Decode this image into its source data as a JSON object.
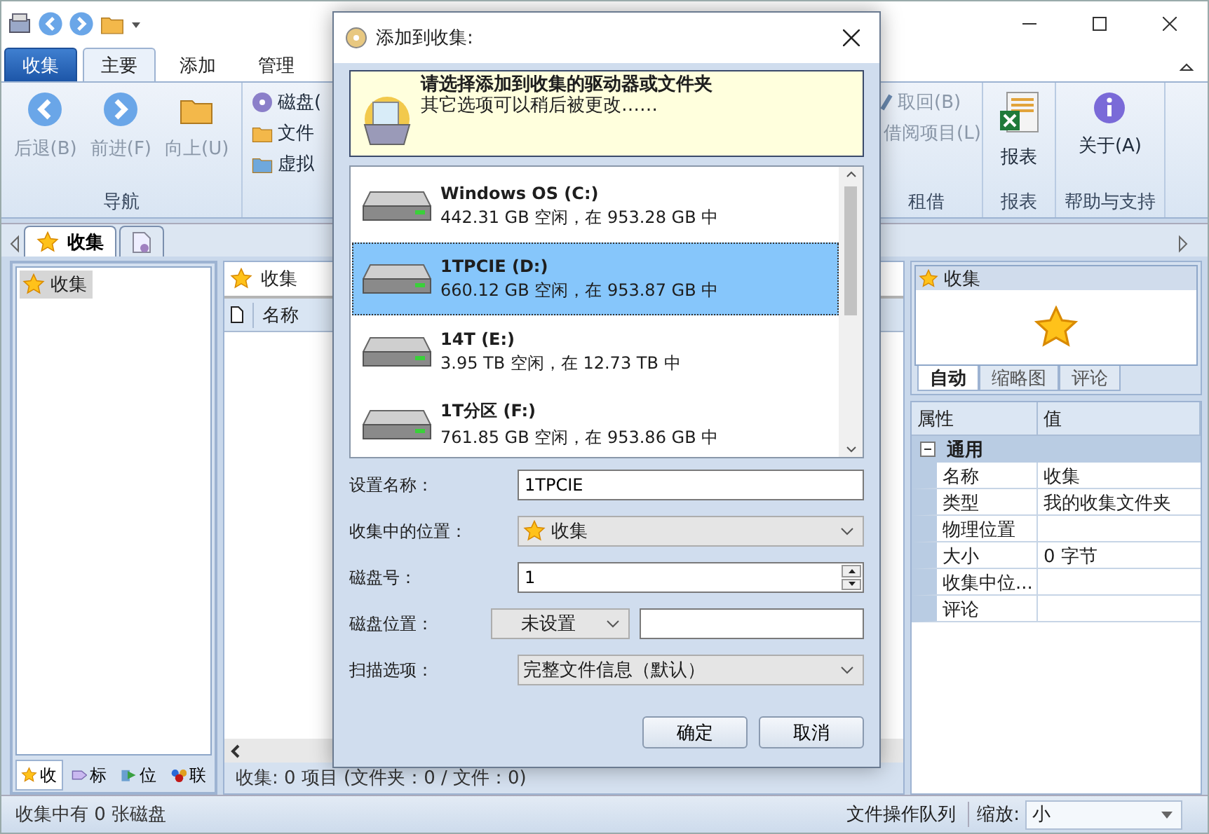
{
  "ribbon": {
    "tabs": [
      {
        "label": "收集",
        "kind": "file",
        "selected": false
      },
      {
        "label": "主要",
        "kind": "tab",
        "selected": true
      },
      {
        "label": "添加",
        "kind": "tab",
        "selected": false
      },
      {
        "label": "管理",
        "kind": "tab",
        "selected": false
      }
    ],
    "groups": [
      {
        "label": "导航",
        "kind": "large",
        "items": [
          {
            "label": "后退(B)",
            "kind": "back",
            "disabled": true
          },
          {
            "label": "前进(F)",
            "kind": "forward",
            "disabled": true
          },
          {
            "label": "向上(U)",
            "kind": "up",
            "disabled": true
          }
        ]
      },
      {
        "kind": "small",
        "items": [
          {
            "label": "磁盘(",
            "kind": "disc",
            "disabled": false
          },
          {
            "label": "文件",
            "kind": "folder",
            "disabled": false
          },
          {
            "label": "虚拟",
            "kind": "vfolder",
            "disabled": false
          }
        ]
      },
      {
        "label": "租借",
        "kind": "small",
        "items": [
          {
            "label": "取回(B)",
            "kind": "return",
            "disabled": true
          },
          {
            "label": "借阅项目(L)",
            "kind": "lend",
            "disabled": true
          }
        ]
      },
      {
        "label": "报表",
        "kind": "large",
        "items": [
          {
            "label": "报表",
            "kind": "sheet",
            "disabled": false
          }
        ]
      },
      {
        "label": "帮助与支持",
        "kind": "large",
        "items": [
          {
            "label": "关于(A)",
            "kind": "info",
            "disabled": false
          }
        ]
      }
    ]
  },
  "doc_tabs": [
    {
      "label": "收集",
      "kind": "star",
      "selected": true
    },
    {
      "kind": "document",
      "selected": false
    }
  ],
  "tree": {
    "items": [
      {
        "label": "收集",
        "selected": true
      }
    ]
  },
  "left_tabs": [
    {
      "label": "收",
      "kind": "star",
      "selected": true
    },
    {
      "label": "标",
      "kind": "tag",
      "selected": false
    },
    {
      "label": "位",
      "kind": "place",
      "selected": false
    },
    {
      "label": "联",
      "kind": "people",
      "selected": false
    }
  ],
  "list_panel": {
    "title": "收集",
    "columns": [
      "名称"
    ],
    "status": "收集: 0 项目 (文件夹：0 / 文件：0)"
  },
  "preview": {
    "title": "收集",
    "tabs": [
      {
        "label": "自动",
        "selected": true
      },
      {
        "label": "缩略图",
        "selected": false
      },
      {
        "label": "评论",
        "selected": false
      }
    ]
  },
  "properties": {
    "columns": [
      "属性",
      "值"
    ],
    "groups": [
      {
        "label": "通用",
        "expanded": true,
        "rows": [
          {
            "name": "名称",
            "value": "收集"
          },
          {
            "name": "类型",
            "value": "我的收集文件夹"
          },
          {
            "name": "物理位置"
          },
          {
            "name": "大小",
            "value": "0 字节"
          },
          {
            "name": "收集中位..."
          },
          {
            "name": "评论"
          }
        ]
      }
    ]
  },
  "status_bar": {
    "text": "收集中有 0 张磁盘",
    "queue": "文件操作队列",
    "zoom_label": "缩放:",
    "zoom_value": "小"
  },
  "dialog": {
    "title": "添加到收集:",
    "heading": "请选择添加到收集的驱动器或文件夹",
    "subheading": "其它选项可以稍后被更改……",
    "drives": [
      {
        "name": "Windows OS (C:)",
        "info": "442.31 GB 空闲，在 953.28 GB 中",
        "selected": false
      },
      {
        "name": "1TPCIE (D:)",
        "info": "660.12 GB 空闲，在 953.87 GB 中",
        "selected": true
      },
      {
        "name": "14T (E:)",
        "info": "3.95 TB 空闲，在 12.73 TB 中",
        "selected": false
      },
      {
        "name": "1T分区 (F:)",
        "info": "761.85 GB 空闲，在 953.86 GB 中",
        "selected": false
      }
    ],
    "fields": [
      {
        "kind": "text",
        "label": "设置名称：",
        "value": "1TPCIE"
      },
      {
        "kind": "collection",
        "label": "收集中的位置：",
        "value": "收集"
      },
      {
        "kind": "spin",
        "label": "磁盘号：",
        "value": "1"
      },
      {
        "kind": "location",
        "label": "磁盘位置：",
        "value": "未设置"
      },
      {
        "kind": "select",
        "label": "扫描选项：",
        "value": "完整文件信息（默认）"
      }
    ],
    "buttons": [
      "确定",
      "取消"
    ]
  }
}
